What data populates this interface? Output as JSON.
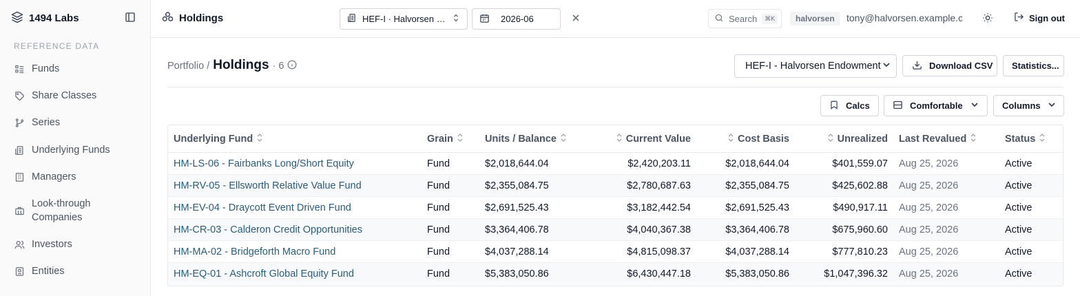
{
  "sidebar": {
    "brand": "1494 Labs",
    "section_label": "REFERENCE DATA",
    "items": [
      {
        "label": "Funds",
        "icon": "list-icon"
      },
      {
        "label": "Share Classes",
        "icon": "tag-icon"
      },
      {
        "label": "Series",
        "icon": "branch-icon"
      },
      {
        "label": "Underlying Funds",
        "icon": "fund-icon"
      },
      {
        "label": "Managers",
        "icon": "building-icon"
      },
      {
        "label": "Look-through\nCompanies",
        "icon": "briefcase-icon"
      },
      {
        "label": "Investors",
        "icon": "users-icon"
      },
      {
        "label": "Entities",
        "icon": "entity-icon"
      }
    ]
  },
  "topbar": {
    "title": "Holdings",
    "fund_select": "HEF-I · Halvorsen Endowment",
    "period": "2026-06",
    "search_placeholder": "Search",
    "search_shortcut": "⌘K",
    "user_badge": "halvorsen",
    "user_email": "tony@halvorsen.example.com",
    "sign_out": "Sign out"
  },
  "page": {
    "breadcrumb_parent": "Portfolio /",
    "title": "Holdings",
    "count": "· 6",
    "fund_dropdown": "HEF-I - Halvorsen Endowment",
    "download_csv": "Download CSV",
    "statistics": "Statistics...",
    "calcs": "Calcs",
    "density": "Comfortable",
    "columns": "Columns"
  },
  "table": {
    "headers": {
      "underlying_fund": "Underlying Fund",
      "grain": "Grain",
      "units_balance": "Units / Balance",
      "current_value": "Current Value",
      "cost_basis": "Cost Basis",
      "unrealized": "Unrealized",
      "last_revalued": "Last Revalued",
      "status": "Status"
    },
    "rows": [
      {
        "fund": "HM-LS-06 - Fairbanks Long/Short Equity",
        "grain": "Fund",
        "units": "$2,018,644.04",
        "current": "$2,420,203.11",
        "cost": "$2,018,644.04",
        "unrealized": "$401,559.07",
        "revalued": "Aug 25, 2026",
        "status": "Active"
      },
      {
        "fund": "HM-RV-05 - Ellsworth Relative Value Fund",
        "grain": "Fund",
        "units": "$2,355,084.75",
        "current": "$2,780,687.63",
        "cost": "$2,355,084.75",
        "unrealized": "$425,602.88",
        "revalued": "Aug 25, 2026",
        "status": "Active"
      },
      {
        "fund": "HM-EV-04 - Draycott Event Driven Fund",
        "grain": "Fund",
        "units": "$2,691,525.43",
        "current": "$3,182,442.54",
        "cost": "$2,691,525.43",
        "unrealized": "$490,917.11",
        "revalued": "Aug 25, 2026",
        "status": "Active"
      },
      {
        "fund": "HM-CR-03 - Calderon Credit Opportunities",
        "grain": "Fund",
        "units": "$3,364,406.78",
        "current": "$4,040,367.38",
        "cost": "$3,364,406.78",
        "unrealized": "$675,960.60",
        "revalued": "Aug 25, 2026",
        "status": "Active"
      },
      {
        "fund": "HM-MA-02 - Bridgeforth Macro Fund",
        "grain": "Fund",
        "units": "$4,037,288.14",
        "current": "$4,815,098.37",
        "cost": "$4,037,288.14",
        "unrealized": "$777,810.23",
        "revalued": "Aug 25, 2026",
        "status": "Active"
      },
      {
        "fund": "HM-EQ-01 - Ashcroft Global Equity Fund",
        "grain": "Fund",
        "units": "$5,383,050.86",
        "current": "$6,430,447.18",
        "cost": "$5,383,050.86",
        "unrealized": "$1,047,396.32",
        "revalued": "Aug 25, 2026",
        "status": "Active"
      }
    ]
  }
}
